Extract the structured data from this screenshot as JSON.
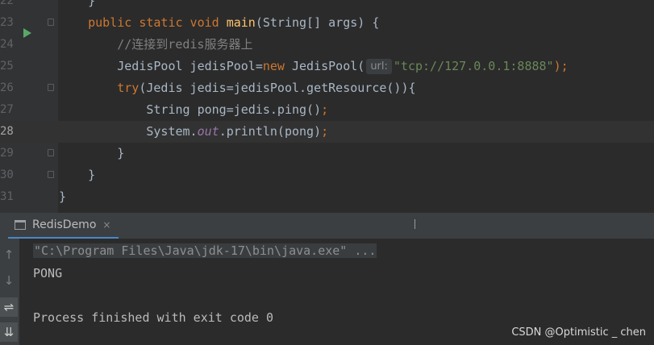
{
  "editor": {
    "lines": [
      {
        "num": "22",
        "tokens": [
          {
            "t": "    ",
            "c": ""
          },
          {
            "t": "}",
            "c": ""
          }
        ]
      },
      {
        "num": "23",
        "tokens": [
          {
            "t": "    ",
            "c": ""
          },
          {
            "t": "public static void ",
            "c": "kw"
          },
          {
            "t": "main",
            "c": "fn"
          },
          {
            "t": "(String[] args) {",
            "c": ""
          }
        ]
      },
      {
        "num": "24",
        "tokens": [
          {
            "t": "        ",
            "c": ""
          },
          {
            "t": "//连接到redis服务器上",
            "c": "cmt"
          }
        ]
      },
      {
        "num": "25",
        "tokens": [
          {
            "t": "        JedisPool jedisPool=",
            "c": ""
          },
          {
            "t": "new ",
            "c": "kw"
          },
          {
            "t": "JedisPool(",
            "c": ""
          },
          {
            "t": "url:",
            "c": "hint"
          },
          {
            "t": "\"tcp://127.0.0.1:8888\"",
            "c": "str"
          },
          {
            "t": ");",
            "c": "kw"
          }
        ]
      },
      {
        "num": "26",
        "tokens": [
          {
            "t": "        ",
            "c": ""
          },
          {
            "t": "try",
            "c": "kw"
          },
          {
            "t": "(Jedis jedis=jedisPool.getResource()){",
            "c": ""
          }
        ]
      },
      {
        "num": "27",
        "tokens": [
          {
            "t": "            String pong=jedis.ping()",
            "c": ""
          },
          {
            "t": ";",
            "c": "kw"
          }
        ]
      },
      {
        "num": "28",
        "tokens": [
          {
            "t": "            System.",
            "c": ""
          },
          {
            "t": "out",
            "c": "field"
          },
          {
            "t": ".println(pong)",
            "c": ""
          },
          {
            "t": ";",
            "c": "kw"
          }
        ]
      },
      {
        "num": "29",
        "tokens": [
          {
            "t": "        }",
            "c": ""
          }
        ]
      },
      {
        "num": "30",
        "tokens": [
          {
            "t": "    }",
            "c": ""
          }
        ]
      },
      {
        "num": "31",
        "tokens": [
          {
            "t": "}",
            "c": ""
          }
        ]
      }
    ]
  },
  "run_panel": {
    "tab_label": "RedisDemo",
    "tab_close": "×"
  },
  "console": {
    "command_line": "\"C:\\Program Files\\Java\\jdk-17\\bin\\java.exe\" ...",
    "output_1": "PONG",
    "output_2": "Process finished with exit code 0"
  },
  "toolbar": {
    "up_icon": "↑",
    "down_icon": "↓",
    "wrap_icon": "⇌",
    "scroll_end_icon": "⇊"
  },
  "watermark": "CSDN @Optimistic _ chen",
  "colors": {
    "background": "#2b2b2b",
    "keyword": "#cc7832",
    "string": "#6a8759",
    "function": "#ffc66d",
    "run_icon": "#59a869",
    "tab_underline": "#4a88c7"
  }
}
